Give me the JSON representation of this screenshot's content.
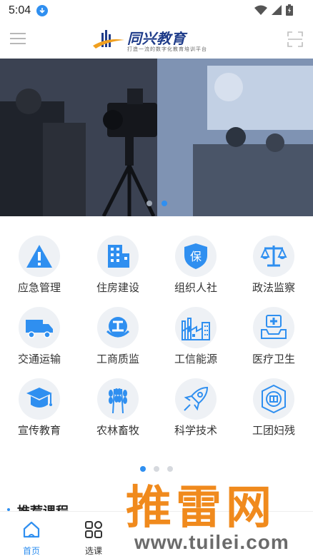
{
  "status": {
    "time": "5:04"
  },
  "header": {
    "brand": "同兴教育",
    "slogan": "打造一流的数字化教育培训平台"
  },
  "banner": {
    "active_slide": 2,
    "slide_count": 2
  },
  "grid": {
    "items": [
      {
        "label": "应急管理",
        "icon": "warning-icon"
      },
      {
        "label": "住房建设",
        "icon": "building-icon"
      },
      {
        "label": "组织人社",
        "icon": "shield-bao-icon"
      },
      {
        "label": "政法监察",
        "icon": "scales-icon"
      },
      {
        "label": "交通运输",
        "icon": "truck-icon"
      },
      {
        "label": "工商质监",
        "icon": "gong-emblem-icon"
      },
      {
        "label": "工信能源",
        "icon": "factory-icon"
      },
      {
        "label": "医疗卫生",
        "icon": "medical-kit-icon"
      },
      {
        "label": "宣传教育",
        "icon": "graduation-cap-icon"
      },
      {
        "label": "农林畜牧",
        "icon": "wheat-icon"
      },
      {
        "label": "科学技术",
        "icon": "rocket-icon"
      },
      {
        "label": "工团妇残",
        "icon": "union-badge-icon"
      }
    ],
    "active_page": 1,
    "page_count": 3
  },
  "recommend": {
    "title": "推荐课程"
  },
  "nav": {
    "items": [
      {
        "label": "首页",
        "icon": "home-icon",
        "active": true
      },
      {
        "label": "选课",
        "icon": "grid-icon",
        "active": false
      }
    ]
  },
  "watermark": {
    "text": "推雷网",
    "url": "www.tuilei.com"
  },
  "colors": {
    "accent": "#2f8ff0",
    "icon_bg": "#eef1f5",
    "watermark": "#f08a1d"
  }
}
